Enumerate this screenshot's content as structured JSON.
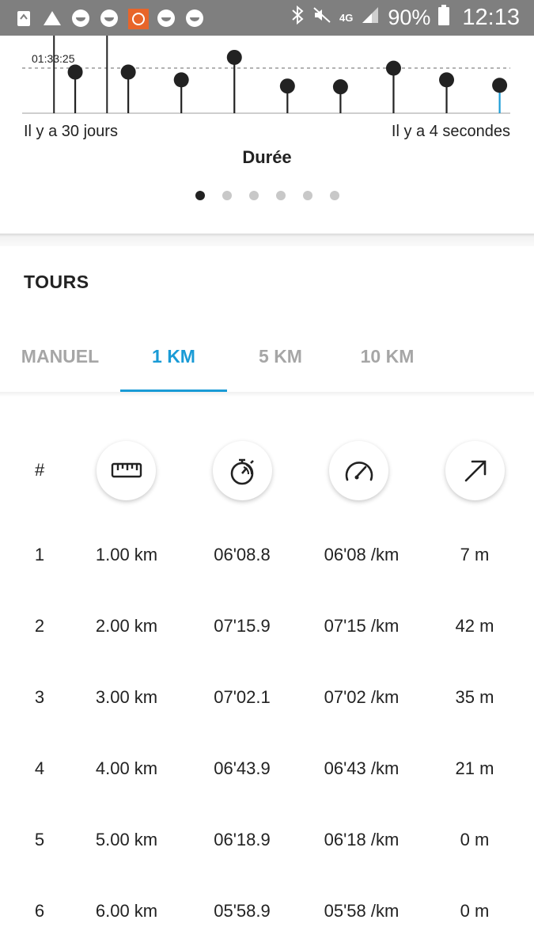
{
  "status_bar": {
    "network": "4G",
    "battery": "90%",
    "time": "12:13"
  },
  "chart": {
    "reference_label": "01:33:25",
    "x_start_label": "Il y a 30 jours",
    "x_end_label": "Il y a 4 secondes",
    "title": "Durée",
    "page_count": 6,
    "active_page": 0
  },
  "chart_data": {
    "type": "scatter",
    "title": "Durée",
    "xlabel": "",
    "ylabel": "",
    "x_tick_labels": [
      "Il y a 30 jours",
      "Il y a 4 secondes"
    ],
    "reference_line": "01:33:25",
    "points": [
      {
        "x": 1,
        "y": 0.53
      },
      {
        "x": 2,
        "y": 0.53
      },
      {
        "x": 3,
        "y": 0.43
      },
      {
        "x": 4,
        "y": 0.72
      },
      {
        "x": 5,
        "y": 0.35
      },
      {
        "x": 6,
        "y": 0.34
      },
      {
        "x": 7,
        "y": 0.58
      },
      {
        "x": 8,
        "y": 0.43
      },
      {
        "x": 9,
        "y": 0.36
      }
    ],
    "markers_without_point": [
      0.6,
      1.6
    ],
    "highlight_last": true,
    "highlight_color": "#1a9bd6"
  },
  "laps": {
    "section_title": "TOURS",
    "tabs": [
      {
        "label": "MANUEL"
      },
      {
        "label": "1 KM"
      },
      {
        "label": "5 KM"
      },
      {
        "label": "10 KM"
      }
    ],
    "active_tab": 1,
    "accent_color": "#1a9bd6",
    "header": {
      "number": "#",
      "icons": [
        "ruler-icon",
        "stopwatch-icon",
        "speedometer-icon",
        "ascent-arrow-icon"
      ]
    },
    "rows": [
      {
        "n": "1",
        "distance": "1.00 km",
        "time": "06'08.8",
        "pace": "06'08 /km",
        "ascent": "7 m"
      },
      {
        "n": "2",
        "distance": "2.00 km",
        "time": "07'15.9",
        "pace": "07'15 /km",
        "ascent": "42 m"
      },
      {
        "n": "3",
        "distance": "3.00 km",
        "time": "07'02.1",
        "pace": "07'02 /km",
        "ascent": "35 m"
      },
      {
        "n": "4",
        "distance": "4.00 km",
        "time": "06'43.9",
        "pace": "06'43 /km",
        "ascent": "21 m"
      },
      {
        "n": "5",
        "distance": "5.00 km",
        "time": "06'18.9",
        "pace": "06'18 /km",
        "ascent": "0 m"
      },
      {
        "n": "6",
        "distance": "6.00 km",
        "time": "05'58.9",
        "pace": "05'58 /km",
        "ascent": "0 m"
      }
    ]
  }
}
